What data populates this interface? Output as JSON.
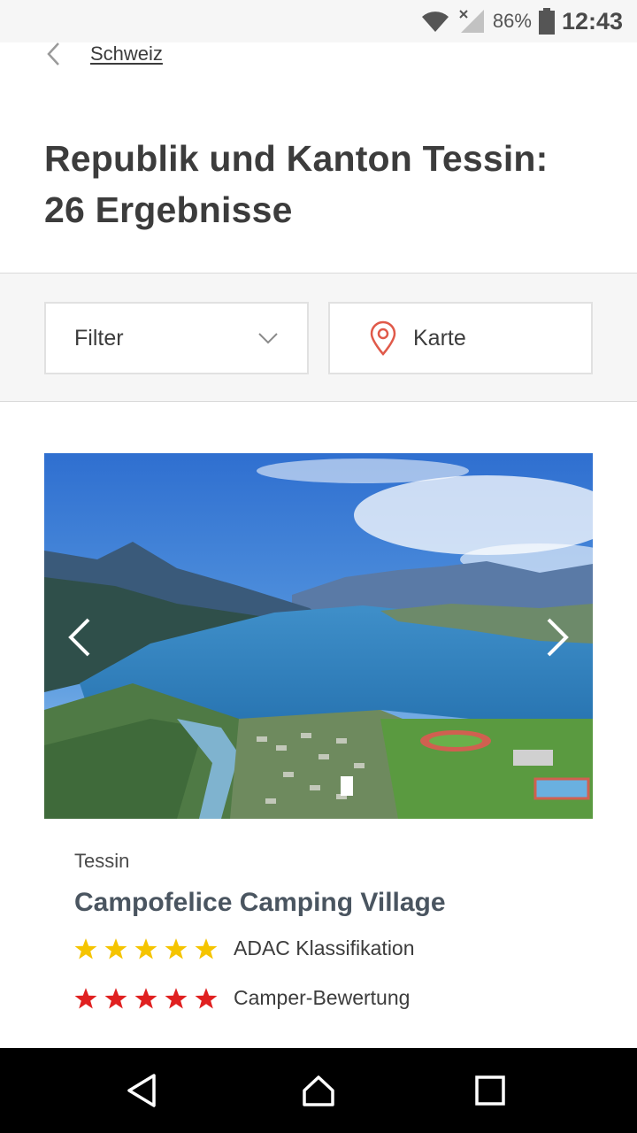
{
  "status_bar": {
    "battery": "86%",
    "time": "12:43",
    "icons": [
      "wifi-icon",
      "signal-icon",
      "battery-icon"
    ]
  },
  "nav": {
    "back_label": "Schweiz",
    "back_icon": "chevron-left-icon"
  },
  "page": {
    "title_line1": "Republik und Kanton Tessin:",
    "title_line2": "26 Ergebnisse"
  },
  "filters": {
    "filter_label": "Filter",
    "filter_icon": "chevron-down-icon",
    "map_label": "Karte",
    "map_icon": "map-pin-icon"
  },
  "result": {
    "region": "Tessin",
    "name": "Campofelice Camping Village",
    "image_icon_prev": "chevron-left-icon",
    "image_icon_next": "chevron-right-icon",
    "ratings": [
      {
        "label": "ADAC Klassifikation",
        "stars": 5,
        "color": "#f5c400"
      },
      {
        "label": "Camper-Bewertung",
        "stars": 5,
        "color": "#e02020"
      }
    ]
  },
  "colors": {
    "accent_pin": "#e05a4a",
    "text_dark": "#3c3c3c"
  },
  "system_nav": [
    "back-icon",
    "home-icon",
    "recents-icon"
  ]
}
